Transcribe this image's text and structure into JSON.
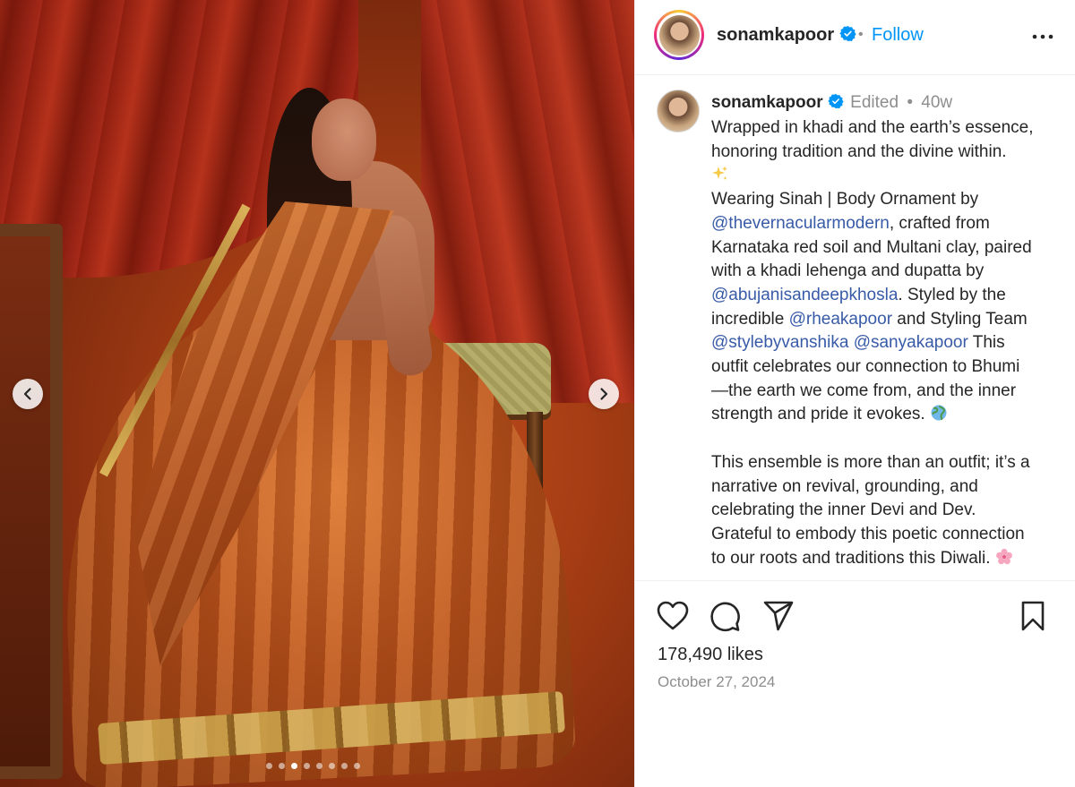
{
  "post": {
    "username": "sonamkapoor",
    "follow_label": "Follow",
    "separator": "•",
    "edited_label": "Edited",
    "age": "40w",
    "likes": "178,490 likes",
    "date": "October 27, 2024",
    "carousel": {
      "total": 8,
      "active_index": 2
    }
  },
  "caption": {
    "l1": "Wrapped in khadi and the earth’s essence,",
    "l2": "honoring tradition and the divine within.",
    "l4": "Wearing Sinah | Body Ornament by",
    "m1": "@thevernacularmodern",
    "l5b": ", crafted from",
    "l6": "Karnataka red soil and Multani clay, paired",
    "l7": "with a khadi lehenga and dupatta by",
    "m2": "@abujanisandeepkhosla",
    "l8b": ". Styled by the",
    "l9a": "incredible ",
    "m3": "@rheakapoor",
    "l9b": " and Styling Team",
    "m4": "@stylebyvanshika",
    "m5": "@sanyakapoor",
    "l10b": " This",
    "l11": "outfit celebrates our connection to Bhumi",
    "l12": "—the earth we come from, and the inner",
    "l13": "strength and pride it evokes. ",
    "l15": "This ensemble is more than an outfit; it’s a",
    "l16": "narrative on revival, grounding, and",
    "l17": "celebrating the inner Devi and Dev.",
    "l18": "Grateful to embody this poetic connection",
    "l19": "to our roots and traditions this Diwali. "
  },
  "icons": {
    "verified": "verified-badge-icon",
    "more": "more-options-icon",
    "sparkles": "sparkles-emoji",
    "globe": "globe-emoji",
    "blossom": "cherry-blossom-emoji",
    "like": "heart-icon",
    "comment": "comment-icon",
    "share": "send-icon",
    "save": "bookmark-icon",
    "prev": "chevron-left-icon",
    "next": "chevron-right-icon"
  },
  "colors": {
    "link": "#385ba8",
    "follow": "#0095f6",
    "verified": "#0095f6",
    "muted": "#8e8e8e"
  }
}
